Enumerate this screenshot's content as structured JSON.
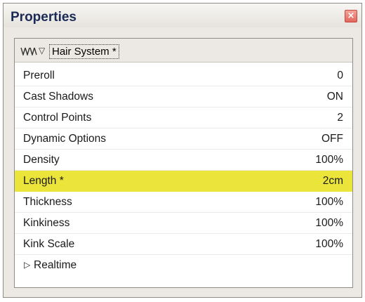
{
  "window": {
    "title": "Properties",
    "close_glyph": "×"
  },
  "panel": {
    "node_label": "Hair System *",
    "node_icon": "hair-system-icon",
    "collapse_glyph": "▽"
  },
  "properties": [
    {
      "label": "Preroll",
      "value": "0"
    },
    {
      "label": "Cast Shadows",
      "value": "ON"
    },
    {
      "label": "Control Points",
      "value": "2"
    },
    {
      "label": "Dynamic Options",
      "value": "OFF"
    },
    {
      "label": "Density",
      "value": "100%"
    },
    {
      "label": "Length *",
      "value": "2cm"
    },
    {
      "label": "Thickness",
      "value": "100%"
    },
    {
      "label": "Kinkiness",
      "value": "100%"
    },
    {
      "label": "Kink Scale",
      "value": "100%"
    }
  ],
  "group": {
    "label": "Realtime",
    "expand_glyph": "▷"
  },
  "colors": {
    "highlight": "#ebe43a",
    "title_text": "#1b2a57",
    "close_button": "#e2665c"
  }
}
